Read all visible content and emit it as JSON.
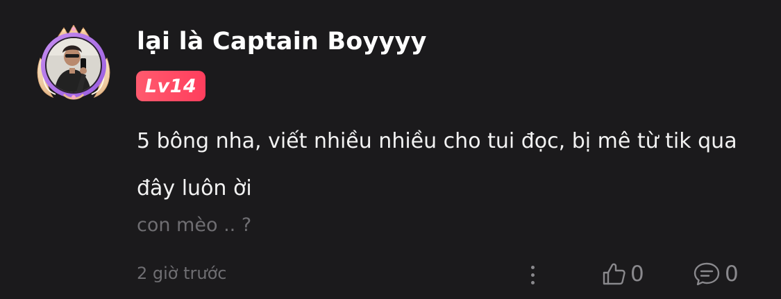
{
  "comment": {
    "username": "lại là Captain Boyyyy",
    "level": "Lv14",
    "body": "5 bông nha, viết nhiều nhiều cho tui đọc, bị mê từ tik qua đây luôn ời",
    "secondary_text": "con mèo .. ?",
    "timestamp": "2 giờ trước",
    "likes": "0",
    "replies": "0"
  },
  "icons": {
    "avatar_frame": "ornate-winged-frame",
    "more": "vertical-dots-icon",
    "like": "thumbs-up-icon",
    "reply": "chat-bubble-icon"
  },
  "colors": {
    "background": "#1b1a1c",
    "level_badge": "#ff4a63",
    "muted_text": "#6f6e72",
    "icon_gray": "#8a898d"
  }
}
